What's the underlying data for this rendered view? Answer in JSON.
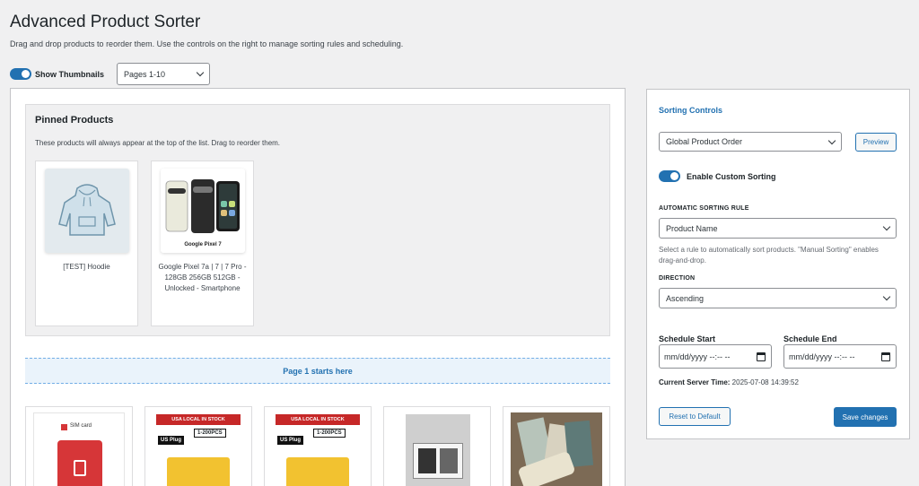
{
  "page": {
    "title": "Advanced Product Sorter",
    "description": "Drag and drop products to reorder them. Use the controls on the right to manage sorting rules and scheduling."
  },
  "toolbar": {
    "thumbnails_toggle_label": "Show Thumbnails",
    "thumbnails_on": true,
    "pages_select_value": "Pages 1-10"
  },
  "pinned": {
    "title": "Pinned Products",
    "description": "These products will always appear at the top of the list. Drag to reorder them.",
    "items": [
      {
        "name": "[TEST] Hoodie",
        "icon": "hoodie-thumbnail"
      },
      {
        "name": "Google Pixel 7a | 7 | 7 Pro - 128GB 256GB 512GB - Unlocked - Smartphone",
        "icon": "pixel-phones-thumbnail",
        "image_caption": "Google Pixel 7"
      }
    ]
  },
  "page_marker": "Page 1 starts here",
  "products_grid": [
    {
      "icon": "sim-card-thumbnail",
      "image_text": "SIM card"
    },
    {
      "icon": "charger-thumbnail",
      "image_text": [
        "USA LOCAL IN STOCK",
        "US Plug",
        "1-200PCS"
      ]
    },
    {
      "icon": "charger-thumbnail",
      "image_text": [
        "USA LOCAL IN STOCK",
        "US Plug",
        "1-200PCS"
      ]
    },
    {
      "icon": "phone-boxes-thumbnail"
    },
    {
      "icon": "phones-pile-thumbnail"
    }
  ],
  "sorting_controls": {
    "title": "Sorting Controls",
    "target_select_value": "Global Product Order",
    "preview_label": "Preview",
    "enable_label": "Enable Custom Sorting",
    "enable_on": true,
    "rule_label": "AUTOMATIC SORTING RULE",
    "rule_value": "Product Name",
    "rule_help": "Select a rule to automatically sort products. \"Manual Sorting\" enables drag-and-drop.",
    "direction_label": "DIRECTION",
    "direction_value": "Ascending",
    "schedule_start_label": "Schedule Start",
    "schedule_end_label": "Schedule End",
    "date_placeholder": "mm/dd/yyyy --:-- --",
    "server_time_label": "Current Server Time:",
    "server_time_value": "2025-07-08 14:39:52",
    "reset_label": "Reset to Default",
    "save_label": "Save changes"
  },
  "colors": {
    "accent": "#2271b1",
    "background": "#f0f0f1"
  }
}
